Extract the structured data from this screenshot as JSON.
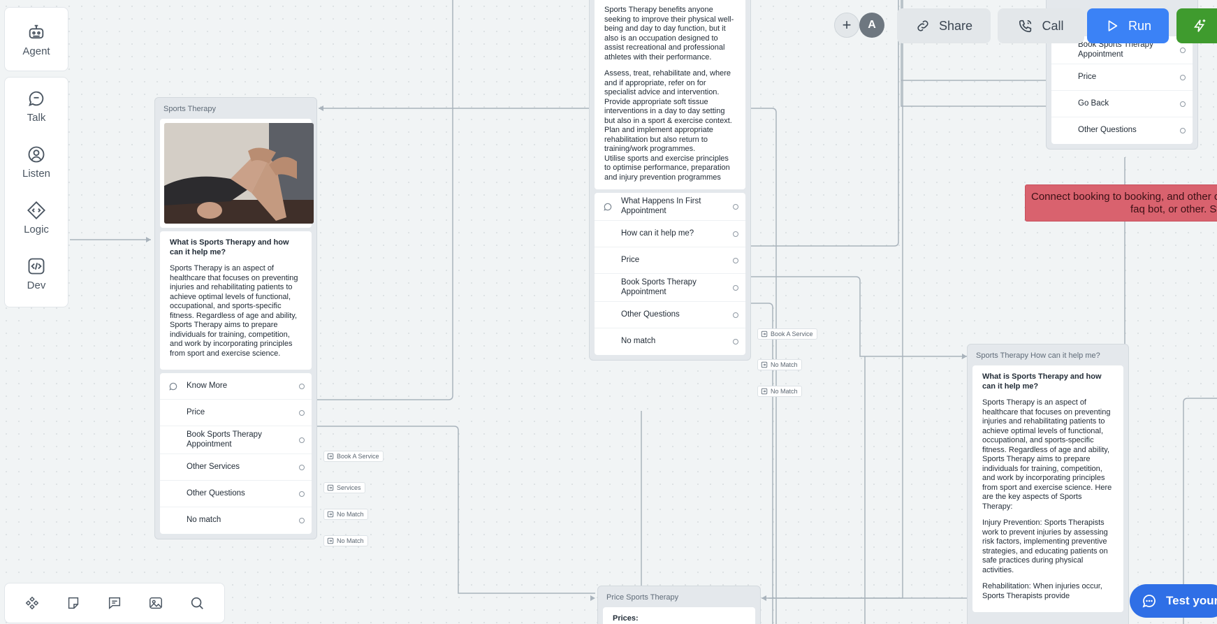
{
  "sidebar": {
    "items": [
      {
        "label": "Agent",
        "icon": "robot-icon"
      },
      {
        "label": "Talk",
        "icon": "chat-bubble-icon"
      },
      {
        "label": "Listen",
        "icon": "ear-person-icon"
      },
      {
        "label": "Logic",
        "icon": "diamond-code-icon"
      },
      {
        "label": "Dev",
        "icon": "code-icon"
      }
    ]
  },
  "bottom_toolbar": {
    "items": [
      "component-icon",
      "note-icon",
      "comment-icon",
      "image-icon",
      "search-icon"
    ]
  },
  "top_controls": {
    "avatar_initial": "A",
    "share_label": "Share",
    "call_label": "Call",
    "run_label": "Run",
    "colors": {
      "run": "#3b82f6",
      "publish": "#3f9b2e"
    }
  },
  "node_left": {
    "title": "Sports Therapy",
    "heading": "What is Sports Therapy and how can it help me?",
    "body": "Sports Therapy is an aspect of healthcare that focuses on preventing injuries and rehabilitating patients to achieve optimal levels of functional, occupational, and sports-specific fitness. Regardless of age and ability, Sports Therapy aims to prepare individuals for training, competition, and work by incorporating principles from sport and exercise science.",
    "choices": [
      {
        "label": "Know More",
        "tag": ""
      },
      {
        "label": "Price",
        "tag": ""
      },
      {
        "label": "Book Sports Therapy Appointment",
        "tag": "Book A Service"
      },
      {
        "label": "Other Services",
        "tag": "Services"
      },
      {
        "label": "Other Questions",
        "tag": "No Match"
      },
      {
        "label": "No match",
        "tag": "No Match"
      }
    ]
  },
  "node_center": {
    "para1": "Sports Therapy benefits anyone seeking to improve their physical well-being and day to day function, but it also is an occupation designed to assist recreational and professional athletes with their performance.",
    "para2": "Assess, treat, rehabilitate and, where and if appropriate, refer on for specialist advice and intervention.",
    "para3": "Provide appropriate soft tissue interventions in a day to day setting but also in a sport & exercise context.",
    "para4": "Plan and implement appropriate rehabilitation but also return to training/work programmes.",
    "para5": "Utilise sports and exercise principles to optimise performance, preparation and injury prevention programmes",
    "choices": [
      {
        "label": "What Happens In First Appointment",
        "tag": ""
      },
      {
        "label": "How can it help me?",
        "tag": ""
      },
      {
        "label": "Price",
        "tag": ""
      },
      {
        "label": "Book Sports Therapy Appointment",
        "tag": "Book A Service"
      },
      {
        "label": "Other Questions",
        "tag": "No Match"
      },
      {
        "label": "No match",
        "tag": "No Match"
      }
    ]
  },
  "node_top_right": {
    "choices": [
      {
        "label": "Book Sports Therapy Appointment"
      },
      {
        "label": "Price"
      },
      {
        "label": "Go Back"
      },
      {
        "label": "Other Questions"
      }
    ]
  },
  "note": {
    "text_line1": "Connect booking to booking, and other c",
    "text_line2": "faq bot, or other. Still fig"
  },
  "node_right": {
    "title": "Sports Therapy How can it help me?",
    "heading": "What is Sports Therapy and how can it help me?",
    "body": "Sports Therapy is an aspect of healthcare that focuses on preventing injuries and rehabilitating patients to achieve optimal levels of functional, occupational, and sports-specific fitness. Regardless of age and ability, Sports Therapy aims to prepare individuals for training, competition, and work by incorporating principles from sport and exercise science. Here are the key aspects of Sports Therapy:",
    "para2": "Injury Prevention: Sports Therapists work to prevent injuries by assessing risk factors, implementing preventive strategies, and educating patients on safe practices during physical activities.",
    "para3": "Rehabilitation: When injuries occur, Sports Therapists provide"
  },
  "node_price": {
    "title": "Price Sports Therapy",
    "body": "Prices:"
  },
  "test_button": {
    "label": "Test your"
  }
}
